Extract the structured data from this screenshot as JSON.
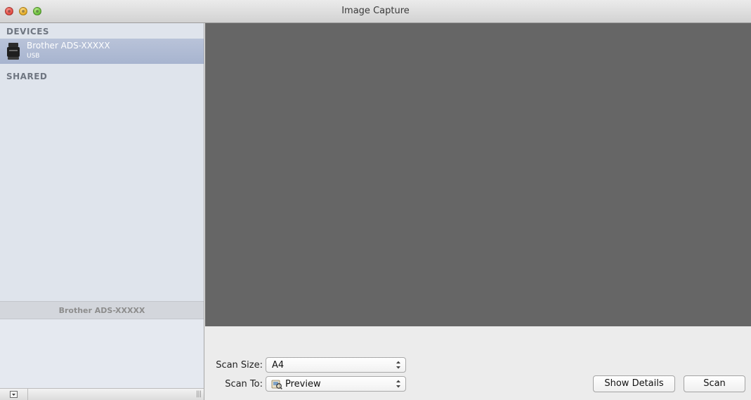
{
  "window": {
    "title": "Image Capture"
  },
  "sidebar": {
    "devices_header": "DEVICES",
    "devices": [
      {
        "name": "Brother ADS-XXXXX",
        "connection": "USB",
        "selected": true
      }
    ],
    "shared_header": "SHARED",
    "info_title": "Brother ADS-XXXXX",
    "footer": {
      "menu_button_icon": "dropdown-square-icon",
      "resize_handle": "|||"
    }
  },
  "controls": {
    "scan_size_label": "Scan Size:",
    "scan_size_value": "A4",
    "scan_to_label": "Scan To:",
    "scan_to_value": "Preview",
    "show_details_label": "Show Details",
    "scan_label": "Scan"
  },
  "colors": {
    "preview_background": "#666666",
    "sidebar_background": "#dfe4ec",
    "selection": "#a7b4cf"
  }
}
